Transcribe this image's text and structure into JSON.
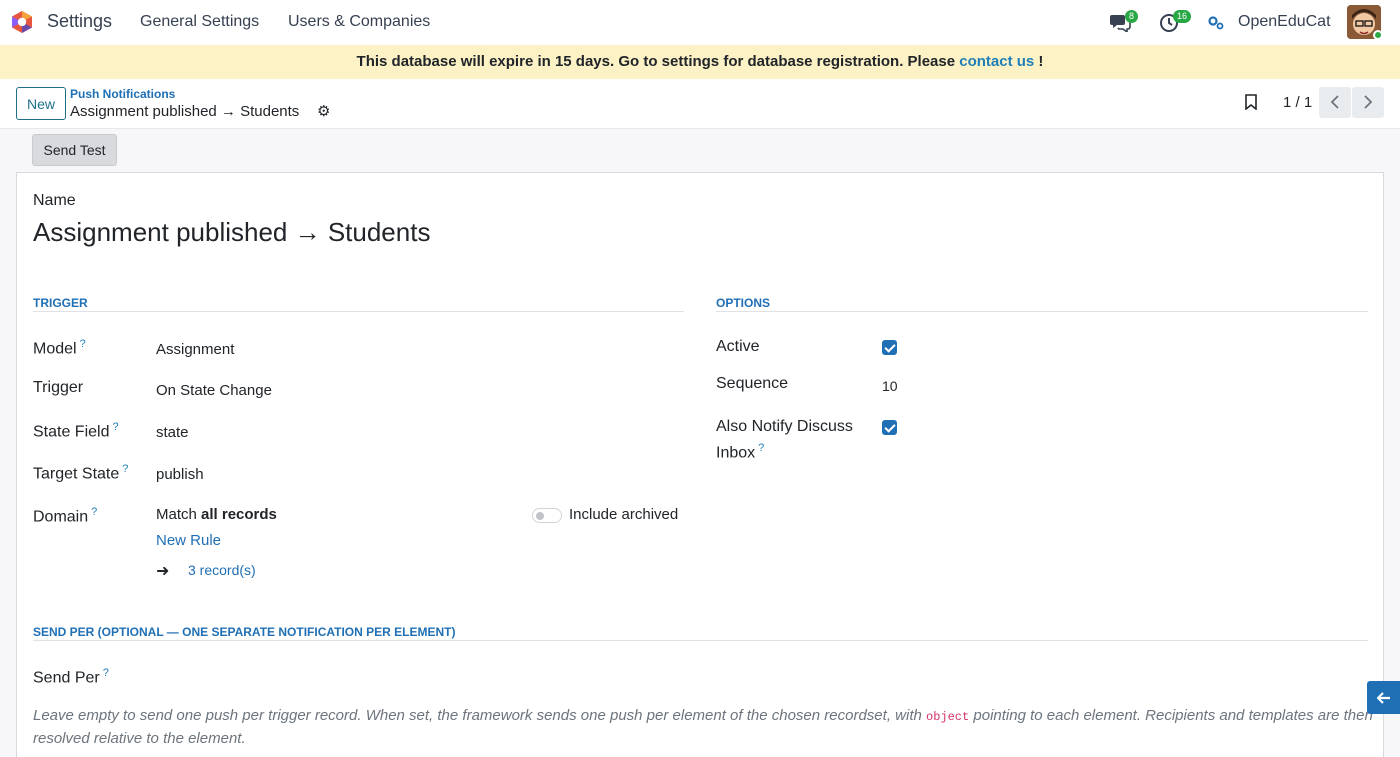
{
  "navbar": {
    "app_name": "Settings",
    "menu": [
      "General Settings",
      "Users & Companies"
    ],
    "messages_count": "8",
    "activities_count": "16",
    "company": "OpenEduCat"
  },
  "banner": {
    "text": "This database will expire in 15 days. Go to settings for database registration. Please ",
    "link": "contact us",
    "suffix": " !"
  },
  "control": {
    "new_label": "New",
    "breadcrumb_parent": "Push Notifications",
    "breadcrumb_current": "Assignment published → Students",
    "pager": "1 / 1"
  },
  "actions": {
    "send_test": "Send Test"
  },
  "form": {
    "name_label": "Name",
    "name_value": "Assignment published → Students",
    "trigger_section": "TRIGGER",
    "options_section": "OPTIONS",
    "model_label": "Model",
    "model_value": "Assignment",
    "trigger_label": "Trigger",
    "trigger_value": "On State Change",
    "state_field_label": "State Field",
    "state_field_value": "state",
    "target_state_label": "Target State",
    "target_state_value": "publish",
    "domain_label": "Domain",
    "domain_match": "Match ",
    "domain_match_bold": "all records",
    "include_archived": "Include archived",
    "new_rule": "New Rule",
    "records": "3 record(s)",
    "active_label": "Active",
    "active_checked": true,
    "sequence_label": "Sequence",
    "sequence_value": "10",
    "also_notify_label_1": "Also Notify Discuss",
    "also_notify_label_2": "Inbox",
    "also_notify_checked": true,
    "send_per_section": "SEND PER (OPTIONAL — ONE SEPARATE NOTIFICATION PER ELEMENT)",
    "send_per_label": "Send Per",
    "desc_1": "Leave empty to send one push per trigger record. When set, the framework sends one push per element of the chosen recordset, with ",
    "desc_code": "object",
    "desc_2": " pointing to each element. Recipients and templates are then resolved relative to the element.",
    "help_mark": "?"
  }
}
